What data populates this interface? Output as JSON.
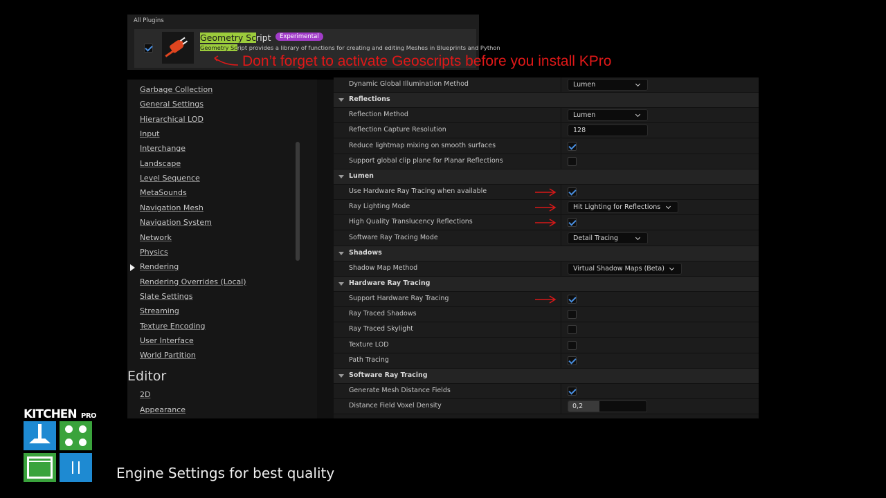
{
  "plugin": {
    "list_header": "All Plugins",
    "title_highlight": "Geometry Sc",
    "title_rest": "ript",
    "badge": "Experimental",
    "desc_highlight": "Geometry Sc",
    "desc_rest": "ript provides a library of functions for creating and editing Meshes in Blueprints and Python",
    "enabled": true
  },
  "annotation": {
    "note": "Don’t forget to activate Geoscripts before you install KPro",
    "note_color": "#e01818"
  },
  "sidebar": {
    "items": [
      {
        "label": "Garbage Collection"
      },
      {
        "label": "General Settings"
      },
      {
        "label": "Hierarchical LOD"
      },
      {
        "label": "Input"
      },
      {
        "label": "Interchange"
      },
      {
        "label": "Landscape"
      },
      {
        "label": "Level Sequence"
      },
      {
        "label": "MetaSounds"
      },
      {
        "label": "Navigation Mesh"
      },
      {
        "label": "Navigation System"
      },
      {
        "label": "Network"
      },
      {
        "label": "Physics"
      },
      {
        "label": "Rendering",
        "active": true
      },
      {
        "label": "Rendering Overrides (Local)"
      },
      {
        "label": "Slate Settings"
      },
      {
        "label": "Streaming"
      },
      {
        "label": "Texture Encoding"
      },
      {
        "label": "User Interface"
      },
      {
        "label": "World Partition"
      }
    ],
    "group_title": "Editor",
    "editor_items": [
      {
        "label": "2D"
      },
      {
        "label": "Appearance"
      }
    ]
  },
  "settings": {
    "rows": [
      {
        "type": "prop",
        "name": "Dynamic Global Illumination Method",
        "control": "dropdown",
        "value": "Lumen"
      },
      {
        "type": "section",
        "name": "Reflections"
      },
      {
        "type": "prop",
        "name": "Reflection Method",
        "control": "dropdown",
        "value": "Lumen"
      },
      {
        "type": "prop",
        "name": "Reflection Capture Resolution",
        "control": "number",
        "value": "128"
      },
      {
        "type": "prop",
        "name": "Reduce lightmap mixing on smooth surfaces",
        "control": "checkbox",
        "checked": true
      },
      {
        "type": "prop",
        "name": "Support global clip plane for Planar Reflections",
        "control": "checkbox",
        "checked": false
      },
      {
        "type": "section",
        "name": "Lumen"
      },
      {
        "type": "prop",
        "name": "Use Hardware Ray Tracing when available",
        "control": "checkbox",
        "checked": true,
        "highlight": true
      },
      {
        "type": "prop",
        "name": "Ray Lighting Mode",
        "control": "dropdown",
        "value": "Hit Lighting for Reflections",
        "highlight": true
      },
      {
        "type": "prop",
        "name": "High Quality Translucency Reflections",
        "control": "checkbox",
        "checked": true,
        "highlight": true
      },
      {
        "type": "prop",
        "name": "Software Ray Tracing Mode",
        "control": "dropdown",
        "value": "Detail Tracing"
      },
      {
        "type": "section",
        "name": "Shadows"
      },
      {
        "type": "prop",
        "name": "Shadow Map Method",
        "control": "dropdown",
        "value": "Virtual Shadow Maps (Beta)"
      },
      {
        "type": "section",
        "name": "Hardware Ray Tracing"
      },
      {
        "type": "prop",
        "name": "Support Hardware Ray Tracing",
        "control": "checkbox",
        "checked": true,
        "highlight": true
      },
      {
        "type": "prop",
        "name": "Ray Traced Shadows",
        "control": "checkbox",
        "checked": false
      },
      {
        "type": "prop",
        "name": "Ray Traced Skylight",
        "control": "checkbox",
        "checked": false
      },
      {
        "type": "prop",
        "name": "Texture LOD",
        "control": "checkbox",
        "checked": false
      },
      {
        "type": "prop",
        "name": "Path Tracing",
        "control": "checkbox",
        "checked": true
      },
      {
        "type": "section",
        "name": "Software Ray Tracing"
      },
      {
        "type": "prop",
        "name": "Generate Mesh Distance Fields",
        "control": "checkbox",
        "checked": true
      },
      {
        "type": "prop",
        "name": "Distance Field Voxel Density",
        "control": "slider",
        "value": "0,2",
        "fraction": 0.4
      }
    ]
  },
  "logo": {
    "word": "KITCHEN",
    "sup": "PRO"
  },
  "caption": "Engine Settings for best quality",
  "colors": {
    "checkbox_check": "#4a90e2",
    "plugin_highlight": "#9ccc3c",
    "badge": "#a13cc8"
  }
}
